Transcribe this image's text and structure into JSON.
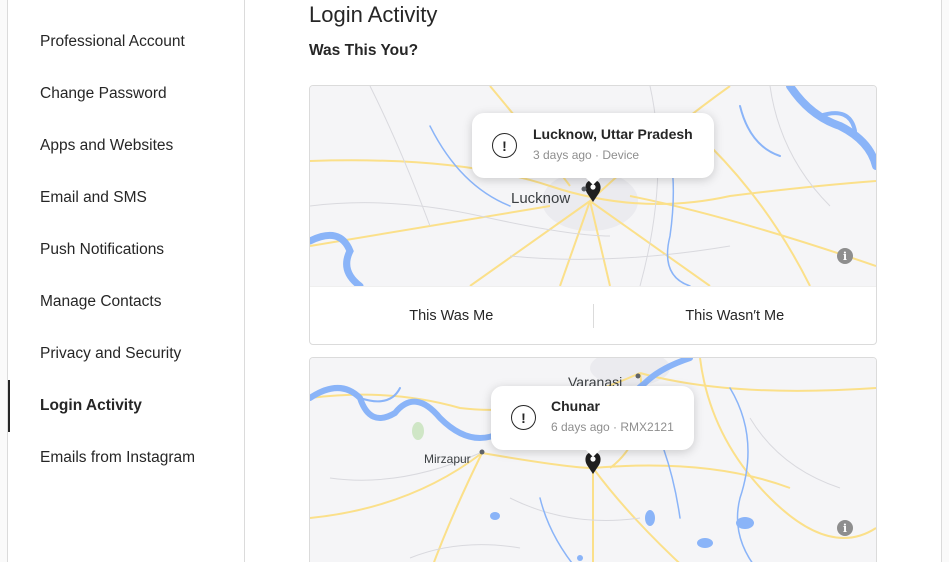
{
  "sidebar": {
    "items": [
      {
        "label": "Professional Account",
        "active": false
      },
      {
        "label": "Change Password",
        "active": false
      },
      {
        "label": "Apps and Websites",
        "active": false
      },
      {
        "label": "Email and SMS",
        "active": false
      },
      {
        "label": "Push Notifications",
        "active": false
      },
      {
        "label": "Manage Contacts",
        "active": false
      },
      {
        "label": "Privacy and Security",
        "active": false
      },
      {
        "label": "Login Activity",
        "active": true
      },
      {
        "label": "Emails from Instagram",
        "active": false
      }
    ]
  },
  "main": {
    "title": "Login Activity",
    "subtitle": "Was This You?",
    "logins": [
      {
        "location": "Lucknow, Uttar Pradesh",
        "meta": "3 days ago · Device",
        "map_label": "Lucknow",
        "confirm_label": "This Was Me",
        "deny_label": "This Wasn′t Me"
      },
      {
        "location": "Chunar",
        "meta": "6 days ago · RMX2121",
        "map_labels": [
          "Varanasi",
          "Mirzapur"
        ]
      }
    ]
  },
  "icons": {
    "alert": "!",
    "info": "i"
  }
}
